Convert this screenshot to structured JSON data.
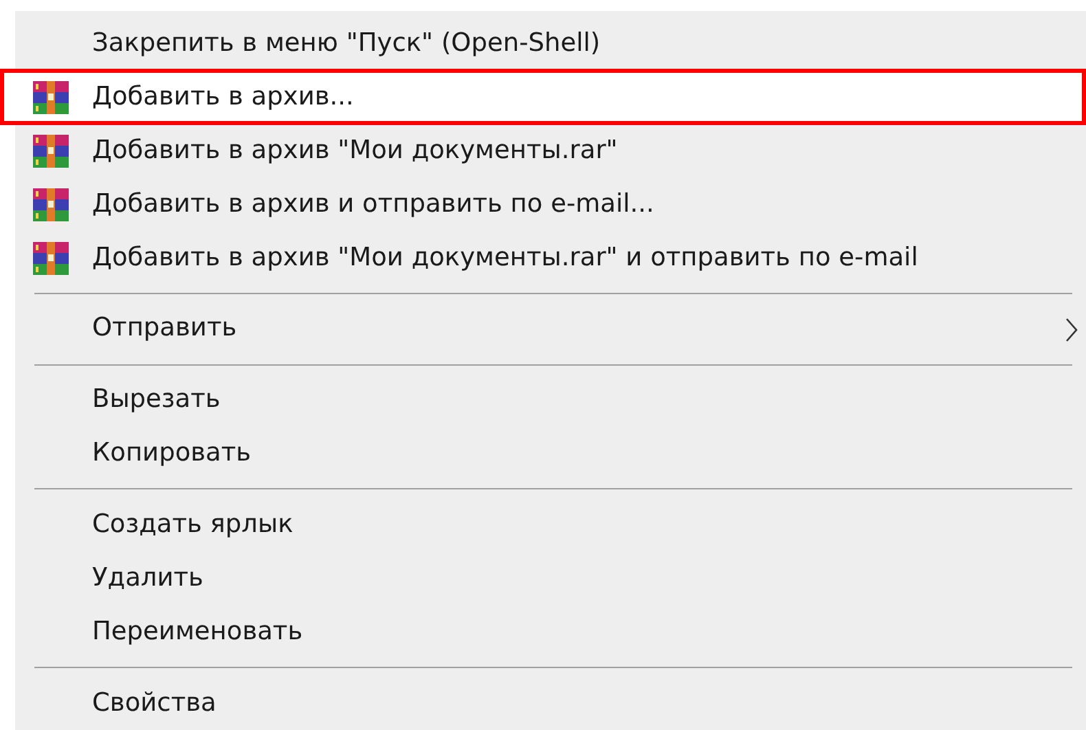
{
  "context_menu": {
    "items": [
      {
        "kind": "item",
        "label": "Закрепить в меню \"Пуск\" (Open-Shell)",
        "icon": false,
        "submenu": false,
        "selected": false
      },
      {
        "kind": "item",
        "label": "Добавить в архив...",
        "icon": true,
        "submenu": false,
        "selected": true
      },
      {
        "kind": "item",
        "label": "Добавить в архив \"Мои документы.rar\"",
        "icon": true,
        "submenu": false,
        "selected": false
      },
      {
        "kind": "item",
        "label": "Добавить в архив и отправить по e-mail...",
        "icon": true,
        "submenu": false,
        "selected": false
      },
      {
        "kind": "item",
        "label": "Добавить в архив \"Мои документы.rar\" и отправить по e-mail",
        "icon": true,
        "submenu": false,
        "selected": false
      },
      {
        "kind": "separator"
      },
      {
        "kind": "item",
        "label": "Отправить",
        "icon": false,
        "submenu": true,
        "selected": false
      },
      {
        "kind": "separator"
      },
      {
        "kind": "item",
        "label": "Вырезать",
        "icon": false,
        "submenu": false,
        "selected": false
      },
      {
        "kind": "item",
        "label": "Копировать",
        "icon": false,
        "submenu": false,
        "selected": false
      },
      {
        "kind": "separator"
      },
      {
        "kind": "item",
        "label": "Создать ярлык",
        "icon": false,
        "submenu": false,
        "selected": false
      },
      {
        "kind": "item",
        "label": "Удалить",
        "icon": false,
        "submenu": false,
        "selected": false
      },
      {
        "kind": "item",
        "label": "Переименовать",
        "icon": false,
        "submenu": false,
        "selected": false
      },
      {
        "kind": "separator"
      },
      {
        "kind": "item",
        "label": "Свойства",
        "icon": false,
        "submenu": false,
        "selected": false
      }
    ]
  }
}
